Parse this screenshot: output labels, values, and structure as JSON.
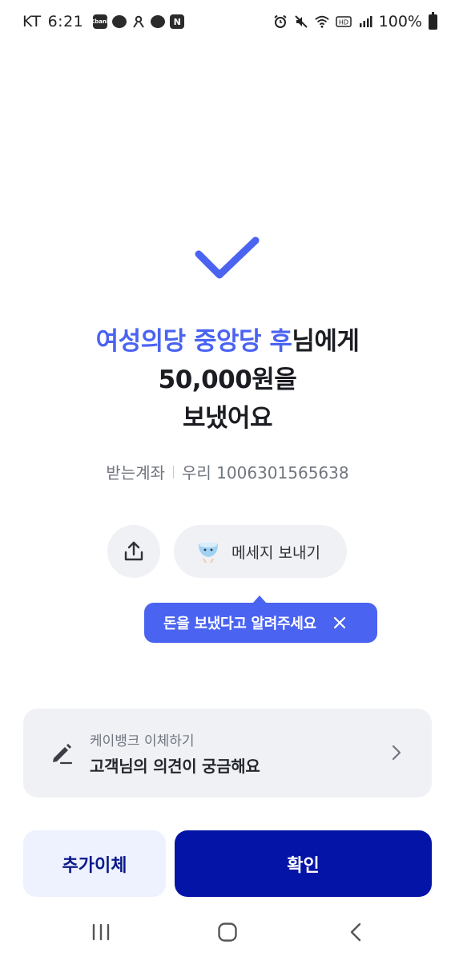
{
  "status_bar": {
    "carrier": "KT",
    "time": "6:21",
    "battery": "100%",
    "notification_icons": [
      "kbank-icon",
      "talk-icon",
      "bell-person-icon",
      "talk-icon",
      "naver-icon"
    ],
    "system_icons": [
      "alarm-icon",
      "mute-icon",
      "wifi-icon",
      "hd-icon",
      "signal-icon"
    ],
    "kbank_badge": "Kbank",
    "naver_badge": "N"
  },
  "result": {
    "recipient": "여성의당 중앙당 후",
    "recipient_suffix": "님에게",
    "amount_line": "50,000원을",
    "verb_line": "보냈어요",
    "accent_color": "#4a63f1"
  },
  "account": {
    "label": "받는계좌",
    "value": "우리 1006301565638"
  },
  "actions": {
    "share_icon": "share-icon",
    "message_label": "메세지 보내기"
  },
  "tooltip": {
    "text": "돈을 보냈다고 알려주세요"
  },
  "feedback": {
    "subtitle": "케이뱅크 이체하기",
    "title": "고객님의 의견이 궁금해요"
  },
  "buttons": {
    "add_transfer": "추가이체",
    "confirm": "확인",
    "confirm_color": "#0414a6"
  },
  "nav": {
    "icons": [
      "recent-apps-icon",
      "home-icon",
      "back-icon"
    ]
  }
}
